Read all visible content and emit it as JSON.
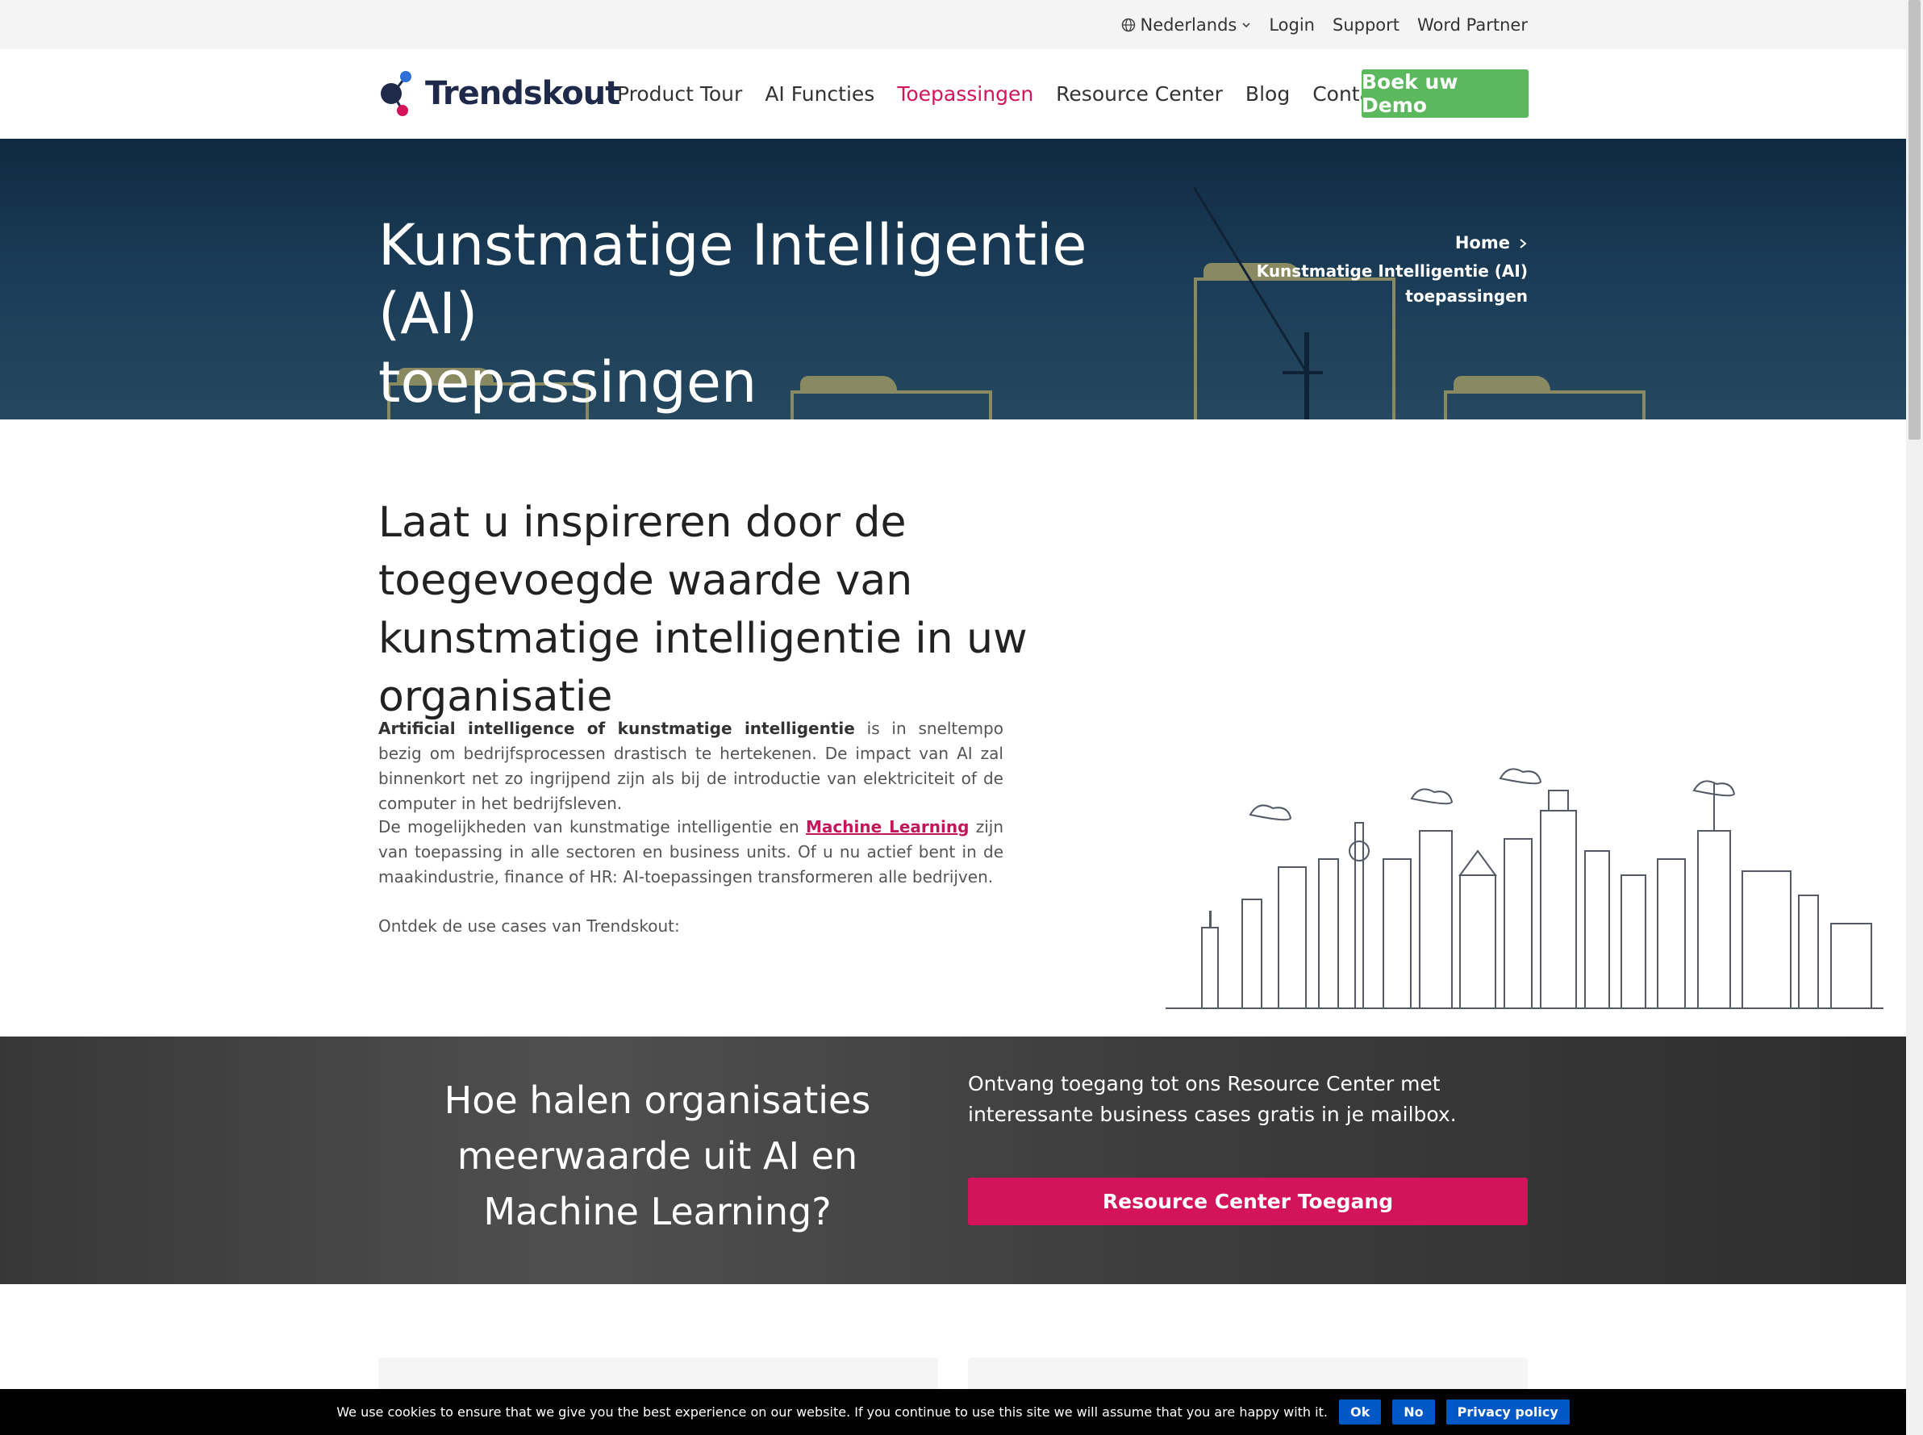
{
  "topbar": {
    "language": "Nederlands",
    "login": "Login",
    "support": "Support",
    "partner": "Word Partner"
  },
  "header": {
    "logo_text": "Trendskout",
    "nav": [
      "Product Tour",
      "AI Functies",
      "Toepassingen",
      "Resource Center",
      "Blog",
      "Contact"
    ],
    "active_nav": "Toepassingen",
    "demo_button": "Boek uw Demo"
  },
  "hero": {
    "title_line1": "Kunstmatige Intelligentie (AI)",
    "title_line2": "toepassingen",
    "breadcrumb_home": "Home",
    "breadcrumb_current_line1": "Kunstmatige Intelligentie (AI)",
    "breadcrumb_current_line2": "toepassingen"
  },
  "intro": {
    "heading": "Laat u inspireren door de toegevoegde waarde van kunstmatige intelligentie in uw organisatie",
    "p1_bold": "Artificial intelligence of kunstmatige intelligentie",
    "p1_rest": " is in sneltempo bezig om bedrijfsprocessen drastisch te hertekenen. De impact van AI zal binnenkort net zo ingrijpend zijn als bij de introductie van elektriciteit of de computer in het bedrijfsleven.",
    "p2_start": "De mogelijkheden van kunstmatige intelligentie en ",
    "p2_link": "Machine Learning",
    "p2_end": " zijn van toepassing in alle sectoren en business units. Of u nu actief bent in de maakindustrie, finance of HR: AI-toepassingen transformeren alle bedrijven.",
    "p3": "Ontdek de use cases van Trendskout:"
  },
  "cta": {
    "heading": "Hoe halen organisaties meerwaarde uit AI en Machine Learning?",
    "text": "Ontvang toegang tot ons Resource Center met interessante business cases gratis in je mailbox.",
    "button": "Resource Center Toegang"
  },
  "cookie": {
    "message": "We use cookies to ensure that we give you the best experience on our website. If you continue to use this site we will assume that you are happy with it.",
    "ok": "Ok",
    "no": "No",
    "privacy": "Privacy policy"
  },
  "colors": {
    "brand_pink": "#d4145a",
    "demo_green": "#5cb85c",
    "cookie_blue": "#0058c6",
    "logo_navy": "#1f2a4a"
  }
}
